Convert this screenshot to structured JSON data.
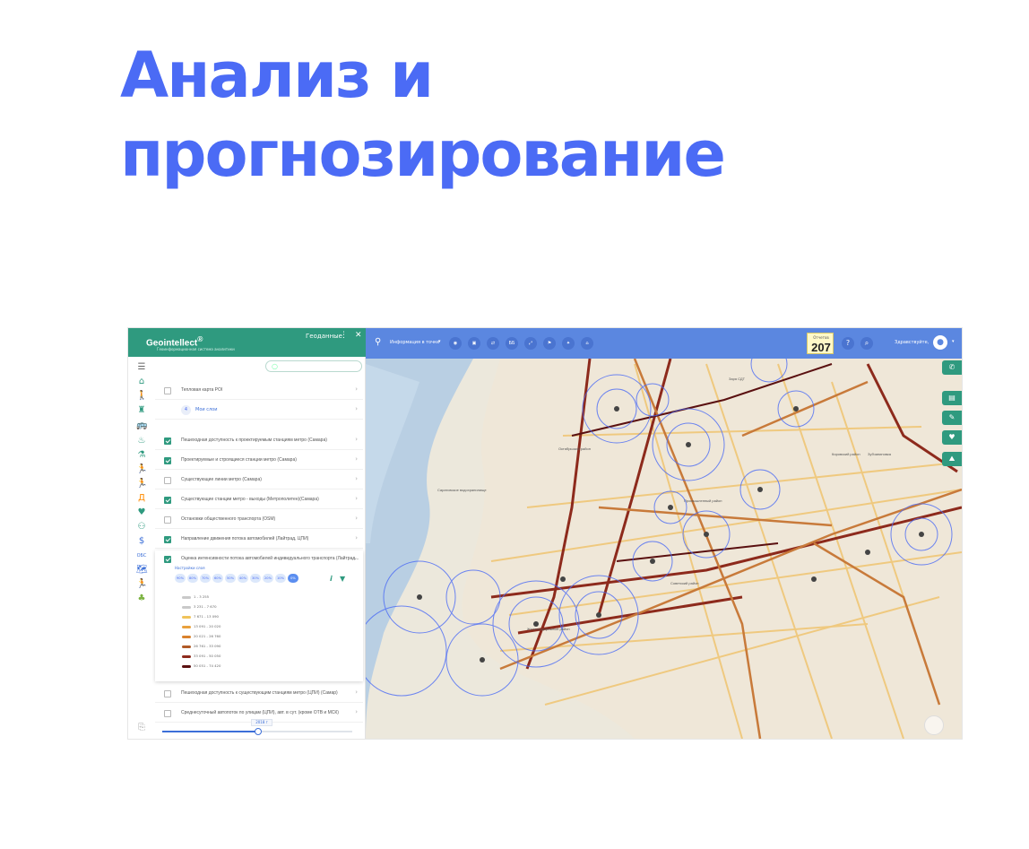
{
  "headline": {
    "line1": "Анализ и",
    "line2": "прогнозирование"
  },
  "app": {
    "brand": {
      "name": "Geointellect",
      "mark": "®",
      "tagline": "Геоинформационная система аналитики"
    },
    "panel": {
      "title": "Геоданные",
      "menu_icon": "⋮",
      "close_icon": "✕",
      "search_placeholder": ""
    },
    "layers": [
      {
        "label": "Тепловая карта POI",
        "checked": false
      },
      {
        "label": "Мои слои",
        "badge": "4",
        "checked": null
      },
      {
        "label": "Пешеходная доступность к проектируемым станциям метро (Самара)",
        "checked": true
      },
      {
        "label": "Проектируемые и строящиеся станции метро (Самара)",
        "checked": true
      },
      {
        "label": "Существующие линии метро (Самара)",
        "checked": false
      },
      {
        "label": "Существующие станции метро - выходы (Метрополитен)(Самара)",
        "checked": true
      },
      {
        "label": "Остановки общественного транспорта (OSM)",
        "checked": false
      },
      {
        "label": "Направление движения потока автомобилей (Лайтрад, ЦПИ)",
        "checked": true
      },
      {
        "label": "Оценка интенсивности потока автомобилей индивидуального транспорта (Лайтрад...",
        "checked": true,
        "expanded": true
      },
      {
        "label": "Пешеходная доступность к существующим станциям метро (ЦПИ) (Самар)",
        "checked": false
      },
      {
        "label": "Среднесуточный автопоток по улицам (ЦПИ), авт. в сут. (кроме ОТВ и МСК)",
        "checked": false
      }
    ],
    "expanded_layer": {
      "settings_label": "Настройки слоя",
      "opacity_chips": [
        "90%",
        "80%",
        "70%",
        "60%",
        "50%",
        "40%",
        "30%",
        "20%",
        "10%",
        "0%"
      ],
      "selected_chip": "0%",
      "info_icon": "i",
      "filter_icon": "▼",
      "legend": [
        {
          "range": "1 - 3 255",
          "color": "#c9c9c9"
        },
        {
          "range": "3 231 - 7 670",
          "color": "#c9c9c9"
        },
        {
          "range": "7 671 - 13 090",
          "color": "#f0c35a"
        },
        {
          "range": "13 091 - 20 020",
          "color": "#e9a13d"
        },
        {
          "range": "20 021 - 26 760",
          "color": "#d9812c"
        },
        {
          "range": "26 761 - 33 090",
          "color": "#b05a26"
        },
        {
          "range": "33 091 - 50 050",
          "color": "#8d2a1c"
        },
        {
          "range": "50 051 - 74 420",
          "color": "#5a1010"
        }
      ]
    },
    "slider": {
      "tooltip": "2018 г",
      "position": 0.5
    },
    "topbar": {
      "mode_label": "Информация в точке",
      "caret": "▾",
      "tool_buttons": [
        "◉",
        "▣",
        "⇄",
        "ББ",
        "⤢",
        "⚑",
        "✦",
        "⌂"
      ],
      "counter_label": "Отчетов",
      "counter_value": "207",
      "help": "?",
      "search": "⌕",
      "user_label": "Здравствуйте,",
      "avatar_icon": "👤"
    },
    "side_tools": [
      "✆",
      "▤",
      "✎",
      "♥",
      "⛰"
    ],
    "map_labels": {
      "river_label": "Саратовское водохранилище",
      "district_1": "Октябрьский район",
      "district_2": "Промышленный район",
      "district_3": "Железнодорожный район",
      "district_4": "Советский район",
      "district_5": "Кировский район",
      "district_6": "Зубчаниновка",
      "top_label": "Заря СДТ"
    },
    "rail_icons": [
      "☰",
      "⌂",
      "🚶",
      "♜",
      "🚌",
      "♨",
      "⚗",
      "🏃",
      "🏃",
      "Д",
      "♥",
      "⚇",
      "$",
      "ОБС",
      "🗺",
      "🏃",
      "♣"
    ],
    "colors": {
      "brand_green": "#2f9a7f",
      "topbar_blue": "#5b87e0",
      "headline_blue": "#4b6bf5"
    }
  }
}
